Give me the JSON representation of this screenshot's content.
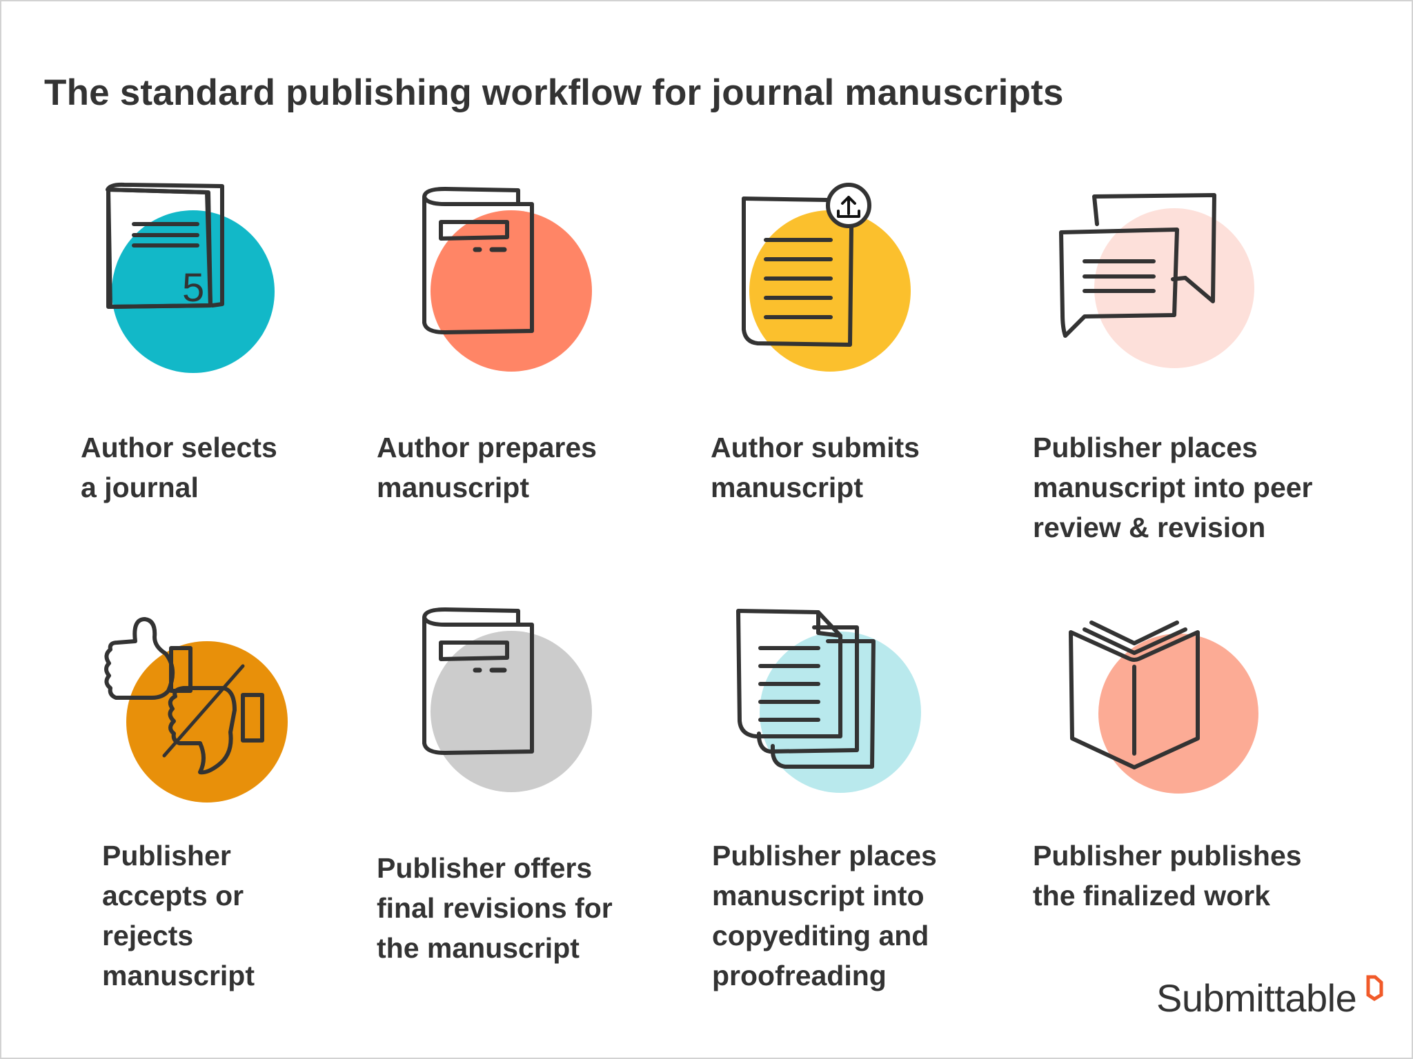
{
  "title": "The standard publishing workflow for journal manuscripts",
  "colors": {
    "teal": "#12b8c8",
    "coral": "#ff8566",
    "yellow": "#fbc02d",
    "pink": "#fde0da",
    "orange": "#e8900a",
    "gray": "#cccccc",
    "light_blue": "#b9e9ed",
    "salmon": "#fcab95",
    "ink": "#333333",
    "brand": "#f15a29"
  },
  "steps": [
    {
      "icon": "journal-icon",
      "lines": [
        "Author selects",
        "a journal"
      ],
      "badge": "5"
    },
    {
      "icon": "book-icon",
      "lines": [
        "Author prepares",
        "manuscript"
      ]
    },
    {
      "icon": "upload-document-icon",
      "lines": [
        "Author submits",
        "manuscript"
      ]
    },
    {
      "icon": "chat-bubbles-icon",
      "lines": [
        "Publisher places",
        "manuscript into peer",
        "review & revision"
      ]
    },
    {
      "icon": "thumbs-up-down-icon",
      "lines": [
        "Publisher",
        "accepts or",
        "rejects",
        "manuscript"
      ]
    },
    {
      "icon": "book-icon",
      "lines": [
        "Publisher offers",
        "final revisions for",
        "the manuscript"
      ]
    },
    {
      "icon": "stacked-documents-icon",
      "lines": [
        "Publisher places",
        "manuscript into",
        "copyediting and",
        "proofreading"
      ]
    },
    {
      "icon": "open-book-icon",
      "lines": [
        "Publisher publishes",
        "the finalized work"
      ]
    }
  ],
  "logo": {
    "text": "Submittable"
  }
}
